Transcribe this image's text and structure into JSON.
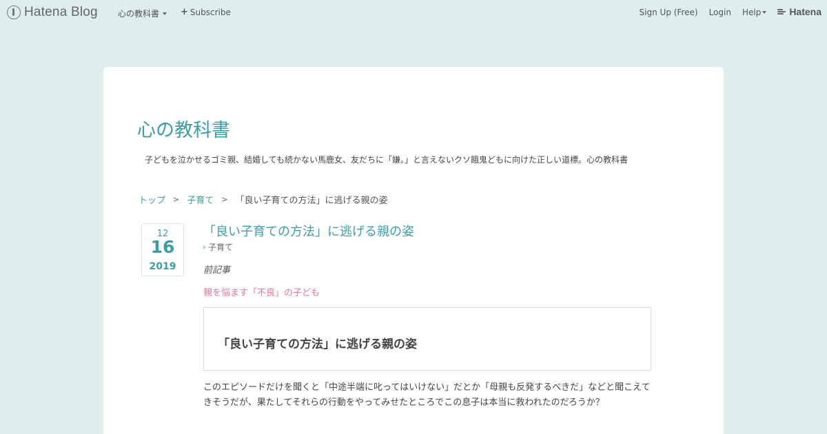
{
  "globalheader": {
    "logo_text": "Hatena Blog",
    "blog_menu_label": "心の教科書",
    "subscribe_label": "Subscribe",
    "signup_label": "Sign Up (Free)",
    "login_label": "Login",
    "help_label": "Help",
    "hatena_label": "Hatena"
  },
  "blog": {
    "title": "心の教科書",
    "description": "子どもを泣かせるゴミ親、結婚しても続かない馬鹿女、友だちに「嫌。」と言えないクソ餓鬼どもに向けた正しい道標。心の教科書"
  },
  "breadcrumb": {
    "top": "トップ",
    "separator": ">",
    "category": "子育て",
    "current": "「良い子育ての方法」に逃げる親の姿"
  },
  "entry": {
    "date": {
      "month": "12",
      "day": "16",
      "year": "2019"
    },
    "title": "「良い子育ての方法」に逃げる親の姿",
    "category": "子育て",
    "prev_label": "前記事",
    "prev_link": "親を悩ます「不良」の子ども",
    "embed_title": "「良い子育ての方法」に逃げる親の姿",
    "body": "このエピソードだけを聞くと「中途半端に叱ってはいけない」だとか「母親も反発するべきだ」などと聞こえてきそうだが、果たしてそれらの行動をやってみせたところでこの息子は本当に救われたのだろうか？"
  },
  "colors": {
    "background": "#deeded",
    "accent": "#3b9ea4",
    "prev_link": "#e0789a"
  }
}
